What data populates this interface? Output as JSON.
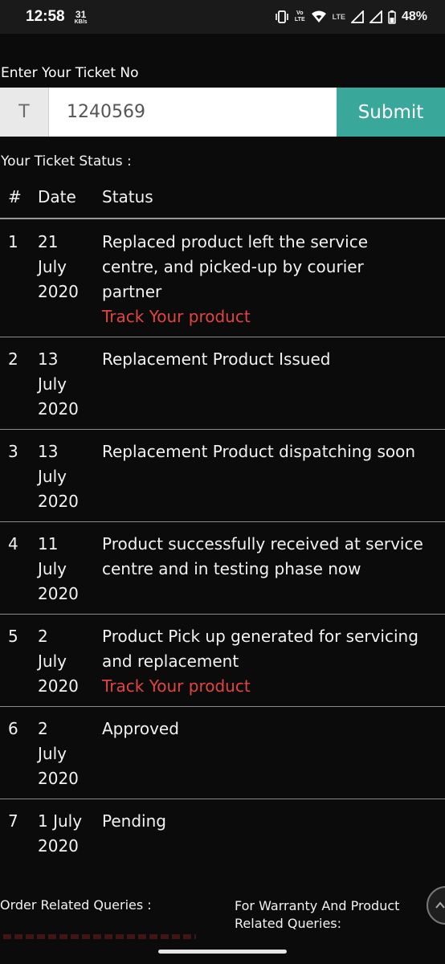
{
  "status_bar": {
    "time": "12:58",
    "net_speed_value": "31",
    "net_speed_unit": "KB/s",
    "volte_top": "Vo",
    "volte_bottom": "LTE",
    "lte": "LTE",
    "battery_percent": "48%"
  },
  "form": {
    "label": "Enter Your Ticket No",
    "prefix": "T",
    "ticket_value": "1240569",
    "submit_label": "Submit"
  },
  "status": {
    "heading": "Your Ticket Status :",
    "columns": {
      "num": "#",
      "date": "Date",
      "status": "Status"
    },
    "rows": [
      {
        "num": "1",
        "date_day": "21",
        "date_month": "July",
        "date_year": "2020",
        "text": "Replaced product left the service centre, and picked-up by courier partner",
        "link": "Track Your product"
      },
      {
        "num": "2",
        "date_day": "13",
        "date_month": "July",
        "date_year": "2020",
        "text": "Replacement Product Issued"
      },
      {
        "num": "3",
        "date_day": "13",
        "date_month": "July",
        "date_year": "2020",
        "text": "Replacement Product dispatching soon"
      },
      {
        "num": "4",
        "date_day": "11",
        "date_month": "July",
        "date_year": "2020",
        "text": "Product successfully received at service centre and in testing phase now"
      },
      {
        "num": "5",
        "date_day": "2",
        "date_month": "July",
        "date_year": "2020",
        "text": "Product Pick up generated for servicing and replacement",
        "link": "Track Your product"
      },
      {
        "num": "6",
        "date_day": "2",
        "date_month": "July",
        "date_year": "2020",
        "text": "Approved"
      },
      {
        "num": "7",
        "date_day": "1 July",
        "date_month": "2020",
        "date_year": "",
        "text": "Pending"
      }
    ]
  },
  "footer": {
    "left_title": "Order Related Queries :",
    "right_title_line1": "For Warranty And Product",
    "right_title_line2": "Related Queries:"
  },
  "colors": {
    "accent": "#3aa79b",
    "link": "#e2453f",
    "background": "#0b0b0b"
  }
}
